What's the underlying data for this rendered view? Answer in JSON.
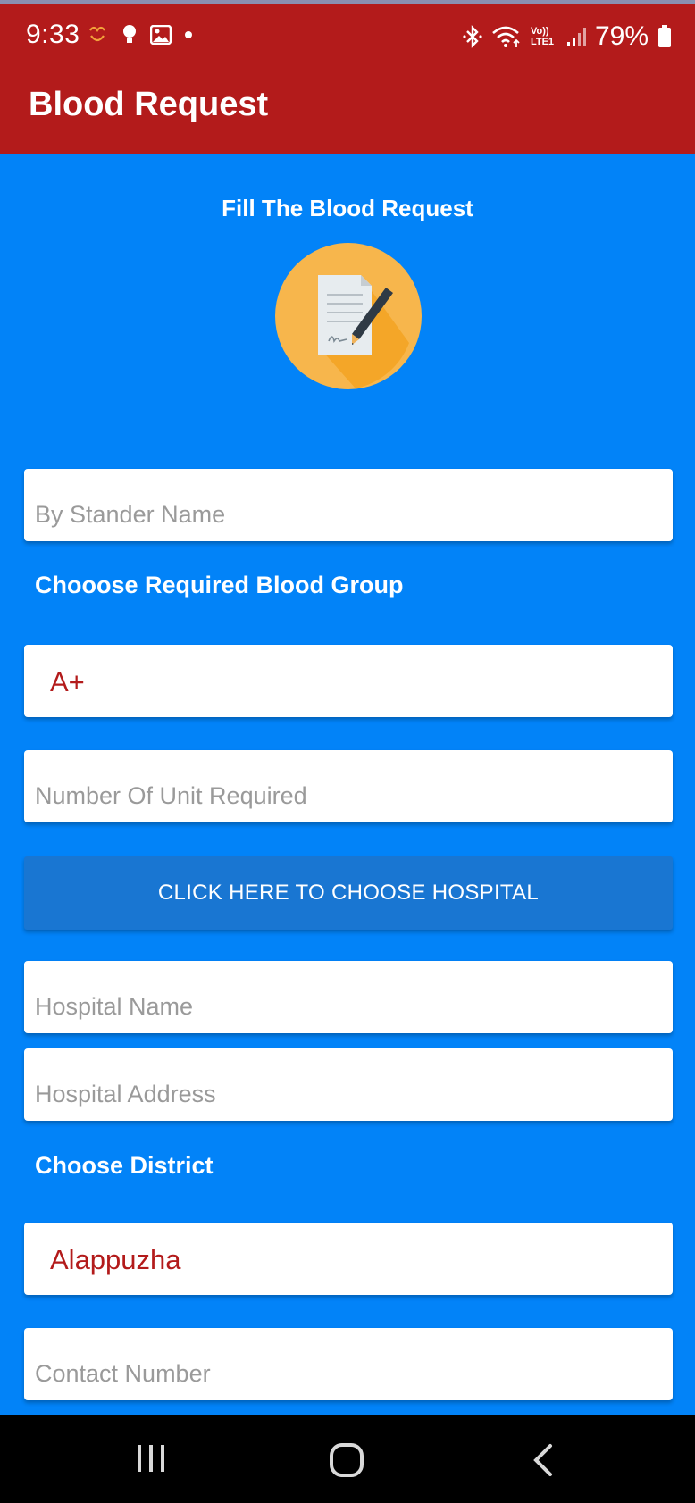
{
  "status_bar": {
    "time": "9:33",
    "battery": "79%",
    "network_label": "Vo)) LTE1"
  },
  "app_bar": {
    "title": "Blood Request"
  },
  "form": {
    "heading": "Fill The Blood Request",
    "bystander_placeholder": "By Stander Name",
    "blood_group_label": "Chooose Required Blood Group",
    "blood_group_value": "A+",
    "units_placeholder": "Number Of Unit Required",
    "choose_hospital_button": "CLICK HERE TO CHOOSE HOSPITAL",
    "hospital_name_placeholder": "Hospital Name",
    "hospital_address_placeholder": "Hospital Address",
    "district_label": "Choose District",
    "district_value": "Alappuzha",
    "contact_placeholder": "Contact Number"
  },
  "colors": {
    "app_bar": "#b31b1b",
    "background": "#0283f8",
    "button": "#1976d2",
    "select_text": "#b31b1b"
  },
  "icons": [
    "document-sign-icon",
    "bluetooth-icon",
    "wifi-icon",
    "signal-icon",
    "battery-icon",
    "recent-apps-icon",
    "home-icon",
    "back-icon"
  ]
}
